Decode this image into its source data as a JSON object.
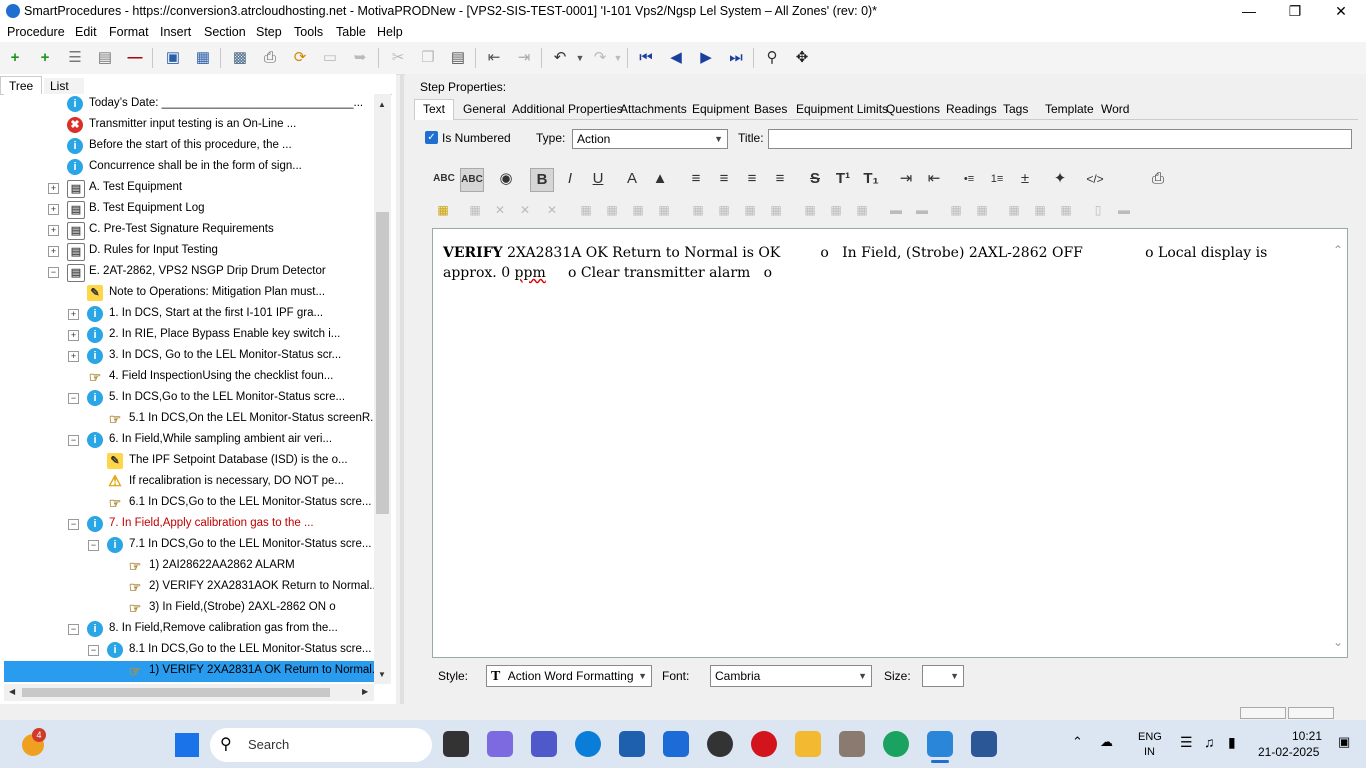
{
  "window": {
    "title": "SmartProcedures - https://conversion3.atrcloudhosting.net - MotivaPRODNew - [VPS2-SIS-TEST-0001] 'I-101 Vps2/Ngsp Lel System – All Zones' (rev: 0)*",
    "minimize": "—",
    "restore": "❐",
    "close": "✕"
  },
  "menu": [
    "Procedure",
    "Edit",
    "Format",
    "Insert",
    "Section",
    "Step",
    "Tools",
    "Table",
    "Help"
  ],
  "left_tabs": [
    "Tree",
    "List"
  ],
  "tree": [
    {
      "icon": "info",
      "label": "Today’s Date: ______________________________...",
      "color": "#000"
    },
    {
      "icon": "err",
      "label": "Transmitter input testing is an On-Line ...",
      "color": "#000"
    },
    {
      "icon": "info",
      "label": "Before the start of this procedure, the ...",
      "color": "#000"
    },
    {
      "icon": "info",
      "label": "Concurrence shall be in the form of sign...",
      "color": "#000"
    },
    {
      "icon": "doc",
      "label": "A. Test Equipment",
      "color": "#000",
      "exp": "+"
    },
    {
      "icon": "doc",
      "label": "B. Test Equipment Log",
      "color": "#000",
      "exp": "+"
    },
    {
      "icon": "doc",
      "label": "C. Pre-Test Signature Requirements",
      "color": "#000",
      "exp": "+"
    },
    {
      "icon": "doc",
      "label": "D. Rules for Input Testing",
      "color": "#000",
      "exp": "+"
    },
    {
      "icon": "doc",
      "label": "E. 2AT-2862, VPS2 NSGP Drip Drum Detector",
      "color": "#000",
      "exp": "−"
    },
    {
      "icon": "note",
      "label": "Note to Operations: Mitigation Plan must...",
      "color": "#000"
    },
    {
      "icon": "info",
      "label": "1. In DCS, Start at the first I-101 IPF gra...",
      "color": "#000",
      "exp": "+"
    },
    {
      "icon": "info",
      "label": "2. In RIE, Place Bypass Enable key switch i...",
      "color": "#000",
      "exp": "+"
    },
    {
      "icon": "info",
      "label": "3. In DCS, Go to the LEL Monitor-Status scr...",
      "color": "#000",
      "exp": "+"
    },
    {
      "icon": "hand",
      "label": "4. Field InspectionUsing the checklist foun...",
      "color": "#000"
    },
    {
      "icon": "info",
      "label": "5. In DCS,Go to the LEL Monitor-Status scre...",
      "color": "#000",
      "exp": "−"
    },
    {
      "icon": "hand",
      "label": "5.1 In DCS,On the LEL Monitor-Status screenR...",
      "color": "#000"
    },
    {
      "icon": "info",
      "label": "6. In Field,While sampling ambient air veri...",
      "color": "#000",
      "exp": "−"
    },
    {
      "icon": "note",
      "label": "The IPF Setpoint Database (ISD) is the o...",
      "color": "#000"
    },
    {
      "icon": "warn",
      "label": "If recalibration is necessary, DO NOT pe...",
      "color": "#000"
    },
    {
      "icon": "hand",
      "label": "6.1 In DCS,Go to the LEL Monitor-Status scre...",
      "color": "#000"
    },
    {
      "icon": "info",
      "label": "7. In Field,Apply calibration gas to the ...",
      "color": "#c00000",
      "exp": "−"
    },
    {
      "icon": "info",
      "label": "7.1 In DCS,Go to the LEL Monitor-Status scre...",
      "color": "#000",
      "exp": "−"
    },
    {
      "icon": "hand",
      "label": "1) 2AI28622AA2862 ALARM",
      "color": "#000"
    },
    {
      "icon": "hand",
      "label": "2) VERIFY 2XA2831AOK Return to Normal...",
      "color": "#000"
    },
    {
      "icon": "hand",
      "label": "3) In Field,(Strobe) 2AXL-2862 ON o",
      "color": "#000"
    },
    {
      "icon": "info",
      "label": "8. In Field,Remove calibration gas from the...",
      "color": "#000",
      "exp": "−"
    },
    {
      "icon": "info",
      "label": "8.1 In DCS,Go to the LEL Monitor-Status scre...",
      "color": "#000",
      "exp": "−"
    },
    {
      "icon": "hand",
      "label": "1) VERIFY 2XA2831A OK Return to Normal...",
      "color": "#000",
      "selected": true
    }
  ],
  "step_properties": {
    "heading": "Step Properties:",
    "tabs": [
      "Text",
      "General",
      "Additional Properties",
      "Attachments",
      "Equipment",
      "Bases",
      "Equipment Limits",
      "Questions",
      "Readings",
      "Tags",
      "Template",
      "Word"
    ],
    "is_numbered_label": "Is Numbered",
    "type_label": "Type:",
    "type_value": "Action",
    "title_label": "Title:",
    "title_value": ""
  },
  "editor": {
    "bold_word": "VERIFY",
    "text": " 2XA2831A OK Return to Normal is OK         o   In Field, (Strobe) 2AXL-2862 OFF              o Local display is approx. 0 ",
    "underlined": "ppm",
    "tail": "     o Clear transmitter alarm   o"
  },
  "format_buttons": [
    "ABC",
    "ABC",
    "◉",
    "B",
    "I",
    "U",
    "A",
    "▲",
    "≡",
    "≡",
    "≡",
    "≡",
    "S",
    "T¹",
    "T₁",
    "⇥",
    "⇤",
    "•≡",
    "1≡",
    "±",
    "✦",
    "</>"
  ],
  "bottom": {
    "style_label": "Style:",
    "style_value": "Action Word Formatting",
    "style_glyph": "T",
    "font_label": "Font:",
    "font_value": "Cambria",
    "size_label": "Size:",
    "size_value": ""
  },
  "taskbar": {
    "search_label": "Search",
    "badge": "4",
    "lang": "ENG",
    "region": "IN",
    "time": "10:21",
    "date": "21-02-2025"
  },
  "colors": {
    "selection": "#2a9cf0",
    "accent": "#1f6fd0",
    "red_text": "#c00000"
  }
}
